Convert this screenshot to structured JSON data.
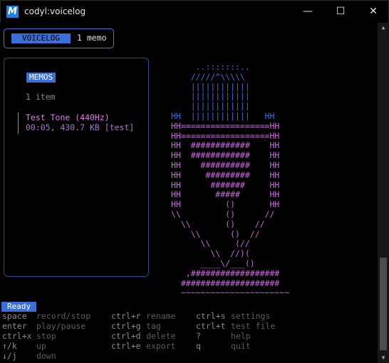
{
  "window": {
    "title": "codyl:voicelog",
    "minimize": "—",
    "maximize": "☐",
    "close": "✕",
    "icon_letter": "M",
    "icon_name": "app-logo"
  },
  "header": {
    "badge": "VOICELOG",
    "count": "1 memo"
  },
  "memos": {
    "title": "MEMOS",
    "count_label": "1 item",
    "items": [
      {
        "name": "Test Tone (440Hz)",
        "meta": "00:05, 430.7 KB [test]"
      }
    ]
  },
  "mic_art": [
    {
      "color": "#3a6fd8",
      "text": "     ..:::::::.. "
    },
    {
      "color": "#3a6fd8",
      "text": "    /////^\\\\\\\\\\ "
    },
    {
      "color": "#3a6fd8",
      "text": "    |||||||||||| "
    },
    {
      "color": "#3a6fd8",
      "text": "    |||||||||||| "
    },
    {
      "color": "#3a6fd8",
      "text": "    |||||||||||| "
    },
    {
      "color": "#3a6fd8",
      "text": "HH  ||||||||||||   HH"
    },
    {
      "color": "#c36ad6",
      "text": "HH==================HH"
    },
    {
      "color": "#c36ad6",
      "text": "HH==================HH"
    },
    {
      "color": "#c36ad6",
      "text": "HH  ############    HH"
    },
    {
      "color": "#c36ad6",
      "text": "HH  ############    HH"
    },
    {
      "color": "#c36ad6",
      "text": "HH    ##########    HH"
    },
    {
      "color": "#c36ad6",
      "text": "HH     #########    HH"
    },
    {
      "color": "#c36ad6",
      "text": "HH      #######     HH"
    },
    {
      "color": "#c36ad6",
      "text": "HH       #####      HH"
    },
    {
      "color": "#c36ad6",
      "text": "HH         ()       HH"
    },
    {
      "color": "#c36ad6",
      "text": "\\\\         ()      //"
    },
    {
      "color": "#c36ad6",
      "text": "  \\\\       ()    //"
    },
    {
      "color": "#c36ad6",
      "text": "    \\\\      ()  //"
    },
    {
      "color": "#c36ad6",
      "text": "      \\\\     (//"
    },
    {
      "color": "#c36ad6",
      "text": "        \\\\  //)("
    },
    {
      "color": "#c36ad6",
      "text": "      ____\\/___()"
    },
    {
      "color": "#c36ad6",
      "text": "   ,##################"
    },
    {
      "color": "#c36ad6",
      "text": "  ####################"
    },
    {
      "color": "#c36ad6",
      "text": "  ~~~~~~~~~~~~~~~~~~~~~~"
    }
  ],
  "status": "Ready",
  "help": [
    {
      "key": "space",
      "desc": "record/stop"
    },
    {
      "key": "enter",
      "desc": "play/pause"
    },
    {
      "key": "ctrl+x",
      "desc": "stop"
    },
    {
      "key": "↑/k",
      "desc": "up"
    },
    {
      "key": "↓/j",
      "desc": "down"
    },
    {
      "key": "ctrl+r",
      "desc": "rename"
    },
    {
      "key": "ctrl+g",
      "desc": "tag"
    },
    {
      "key": "ctrl+d",
      "desc": "delete"
    },
    {
      "key": "ctrl+e",
      "desc": "export"
    },
    {
      "key": "ctrl+s",
      "desc": "settings"
    },
    {
      "key": "ctrl+t",
      "desc": "test file"
    },
    {
      "key": "?",
      "desc": "help"
    },
    {
      "key": "q",
      "desc": "quit"
    }
  ],
  "colors": {
    "accent": "#3a6fd8",
    "memo_accent": "#e07ae6",
    "panel_border": "#2b4a88",
    "background": "#000000"
  }
}
